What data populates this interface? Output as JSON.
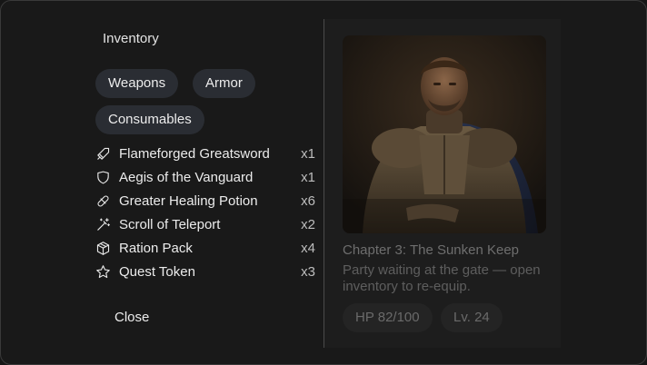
{
  "inventory": {
    "title": "Inventory",
    "filters": [
      "Weapons",
      "Armor",
      "Consumables"
    ],
    "items": [
      {
        "name": "Flameforged Greatsword",
        "qty": "x1",
        "icon": "sword-icon"
      },
      {
        "name": "Aegis of the Vanguard",
        "qty": "x1",
        "icon": "shield-icon"
      },
      {
        "name": "Greater Healing Potion",
        "qty": "x6",
        "icon": "potion-icon"
      },
      {
        "name": "Scroll of Teleport",
        "qty": "x2",
        "icon": "magic-wand-icon"
      },
      {
        "name": "Ration Pack",
        "qty": "x4",
        "icon": "package-icon"
      },
      {
        "name": "Quest Token",
        "qty": "x3",
        "icon": "star-icon"
      }
    ],
    "close_label": "Close"
  },
  "scene": {
    "portrait_icon": "knight-portrait",
    "chapter": "Chapter 3: The Sunken Keep",
    "description": "Party waiting at the gate — open inventory to re-equip.",
    "stats": {
      "hp": "HP 82/100",
      "level": "Lv. 24"
    }
  },
  "colors": {
    "background": "#191919",
    "chip": "#2a2d33",
    "text": "#ececec",
    "muted_text": "#6e6e6e"
  }
}
